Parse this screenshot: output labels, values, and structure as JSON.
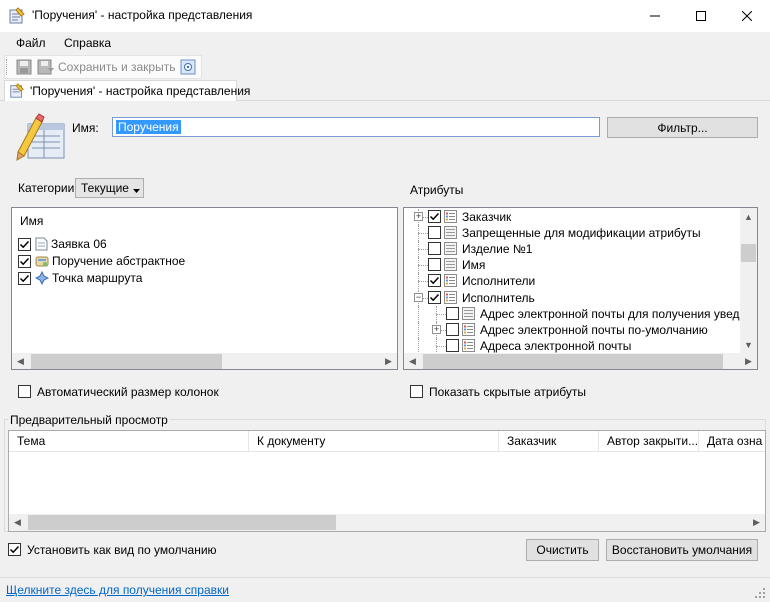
{
  "window": {
    "title": "'Поручения' - настройка представления",
    "minimize_glyph": "—",
    "maximize_glyph": "☐",
    "close_glyph": "✕"
  },
  "menu": [
    {
      "label": "Файл"
    },
    {
      "label": "Справка"
    }
  ],
  "toolbar": {
    "save_close_label": "Сохранить и закрыть"
  },
  "tab": {
    "label": "'Поручения' - настройка представления"
  },
  "form": {
    "name_label": "Имя:",
    "name_value": "Поручения",
    "filter_button": "Фильтр...",
    "categories_label": "Категории",
    "categories_value": "Текущие",
    "attributes_label": "Атрибуты"
  },
  "categories_list": {
    "header": "Имя",
    "items": [
      {
        "label": "Заявка 06",
        "checked": true,
        "icon": "document-icon"
      },
      {
        "label": "Поручение абстрактное",
        "checked": true,
        "icon": "task-icon"
      },
      {
        "label": "Точка маршрута",
        "checked": true,
        "icon": "route-point-icon"
      }
    ]
  },
  "attributes_tree": [
    {
      "label": "Заказчик",
      "checked": true,
      "level": 0,
      "expander": "+",
      "icon": "list-icon-color"
    },
    {
      "label": "Запрещенные для модификации атрибуты",
      "checked": false,
      "level": 0,
      "expander": "",
      "icon": "list-icon-gray"
    },
    {
      "label": "Изделие №1",
      "checked": false,
      "level": 0,
      "expander": "",
      "icon": "list-icon-gray"
    },
    {
      "label": "Имя",
      "checked": false,
      "level": 0,
      "expander": "",
      "icon": "list-icon-gray"
    },
    {
      "label": "Исполнители",
      "checked": true,
      "level": 0,
      "expander": "",
      "icon": "list-icon-color"
    },
    {
      "label": "Исполнитель",
      "checked": true,
      "level": 0,
      "expander": "−",
      "icon": "list-icon-color"
    },
    {
      "label": "Адрес электронной почты для получения уведомле",
      "checked": false,
      "level": 1,
      "expander": "",
      "icon": "list-icon-gray"
    },
    {
      "label": "Адрес электронной почты по-умолчанию",
      "checked": false,
      "level": 1,
      "expander": "+",
      "icon": "list-icon-color"
    },
    {
      "label": "Адреса электронной почты",
      "checked": false,
      "level": 1,
      "expander": "",
      "icon": "list-icon-color"
    }
  ],
  "options": {
    "auto_size_columns": "Автоматический размер колонок",
    "show_hidden_attributes": "Показать скрытые атрибуты",
    "set_default_view": "Установить как вид по умолчанию",
    "set_default_view_checked": true
  },
  "preview": {
    "title": "Предварительный просмотр",
    "columns": [
      "Тема",
      "К документу",
      "Заказчик",
      "Автор закрыти...",
      "Дата озна"
    ]
  },
  "buttons": {
    "clear": "Очистить",
    "restore_defaults": "Восстановить умолчания"
  },
  "status": {
    "help_link": "Щелкните здесь для получения справки"
  }
}
